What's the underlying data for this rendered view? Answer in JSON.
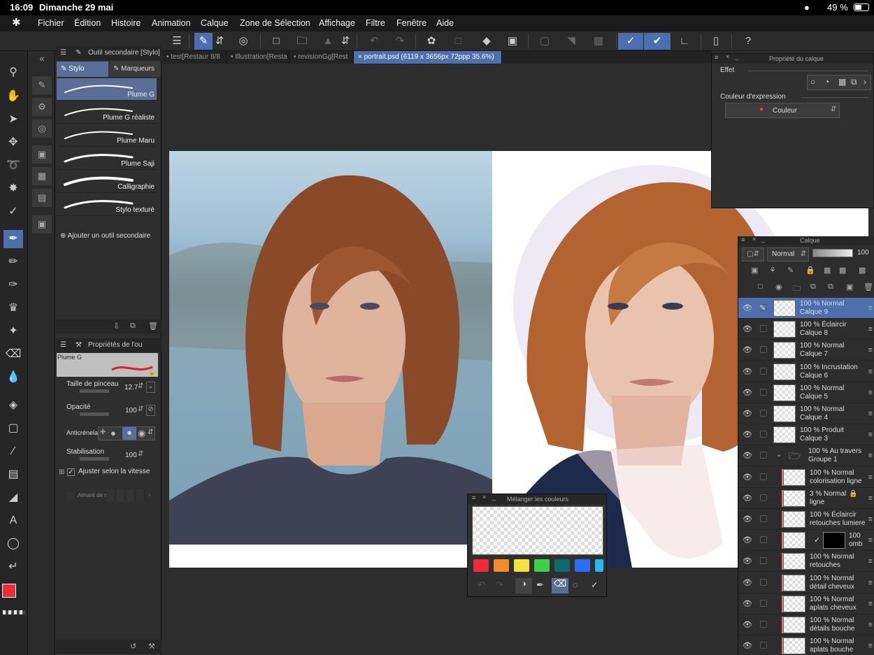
{
  "status": {
    "time": "16:09",
    "date": "Dimanche 29 mai",
    "battery": "49 %"
  },
  "menu": [
    "Fichier",
    "Édition",
    "Histoire",
    "Animation",
    "Calque",
    "Zone de Sélection",
    "Affichage",
    "Filtre",
    "Fenêtre",
    "Aide"
  ],
  "subtool": {
    "title": "Outil secondaire [Stylo]",
    "tabs": [
      "Stylo",
      "Marqueurs"
    ],
    "brushes": [
      "Plume G",
      "Plume G réaliste",
      "Plume Maru",
      "Plume Saji",
      "Calligraphie",
      "Stylo texturé"
    ],
    "add_label": "Ajouter un outil secondaire"
  },
  "toolprops": {
    "title": "Propriétés de l'ou",
    "brush_name": "Plume G",
    "size_label": "Taille de pinceau",
    "size_value": "12.7",
    "opacity_label": "Opacité",
    "opacity_value": "100",
    "aa_label": "Anticrénelag",
    "stab_label": "Stabilisation",
    "stab_value": "100",
    "speed_label": "Ajuster selon la vitesse",
    "magnet_label": "Aimant de r"
  },
  "tabs": [
    "test[Restaur 8/8",
    "Illustration[Resta",
    "revisionGg[Rest",
    "portrait.psd (6119 x 3656px 72ppp 35.6%)"
  ],
  "layerprop": {
    "title": "Propriété du calque",
    "effect_label": "Effet",
    "expr_label": "Couleur d'expression",
    "expr_value": "Couleur"
  },
  "layerpanel": {
    "title": "Calque",
    "blend": "Normal",
    "opacity": "100",
    "layers": [
      {
        "pct": "100 %",
        "mode": "Normal",
        "name": "Calque 9",
        "selected": true
      },
      {
        "pct": "100 %",
        "mode": "Éclaircir",
        "name": "Calque 8"
      },
      {
        "pct": "100 %",
        "mode": "Normal",
        "name": "Calque 7"
      },
      {
        "pct": "100 %",
        "mode": "Incrustation",
        "name": "Calque 6"
      },
      {
        "pct": "100 %",
        "mode": "Normal",
        "name": "Calque 5"
      },
      {
        "pct": "100 %",
        "mode": "Normal",
        "name": "Calque 4"
      },
      {
        "pct": "100 %",
        "mode": "Produit",
        "name": "Calque 3"
      },
      {
        "pct": "100 %",
        "mode": "Au travers",
        "name": "Groupe 1"
      },
      {
        "pct": "100 %",
        "mode": "Normal",
        "name": "colorisation ligne"
      },
      {
        "pct": "3 %",
        "mode": "Normal",
        "name": "ligne"
      },
      {
        "pct": "100 %",
        "mode": "Éclaircir",
        "name": "retouches lumiere"
      },
      {
        "pct": "100",
        "mode": "",
        "name": "omb"
      },
      {
        "pct": "100 %",
        "mode": "Normal",
        "name": "retouches"
      },
      {
        "pct": "100 %",
        "mode": "Normal",
        "name": "détail cheveux"
      },
      {
        "pct": "100 %",
        "mode": "Normal",
        "name": "aplats cheveux"
      },
      {
        "pct": "100 %",
        "mode": "Normal",
        "name": "détails bouche"
      },
      {
        "pct": "100 %",
        "mode": "Normal",
        "name": "aplats bouche"
      }
    ]
  },
  "mixer": {
    "title": "Mélanger les couleurs",
    "swatches": [
      "#ee2b39",
      "#f28c28",
      "#f2e33a",
      "#3fcf4b",
      "#0e6a6e",
      "#2a6ff2",
      "#27b8f2"
    ]
  },
  "colors": {
    "main": "#ee2b39",
    "sub": "#ffffff",
    "accent": "#4d6fae"
  }
}
